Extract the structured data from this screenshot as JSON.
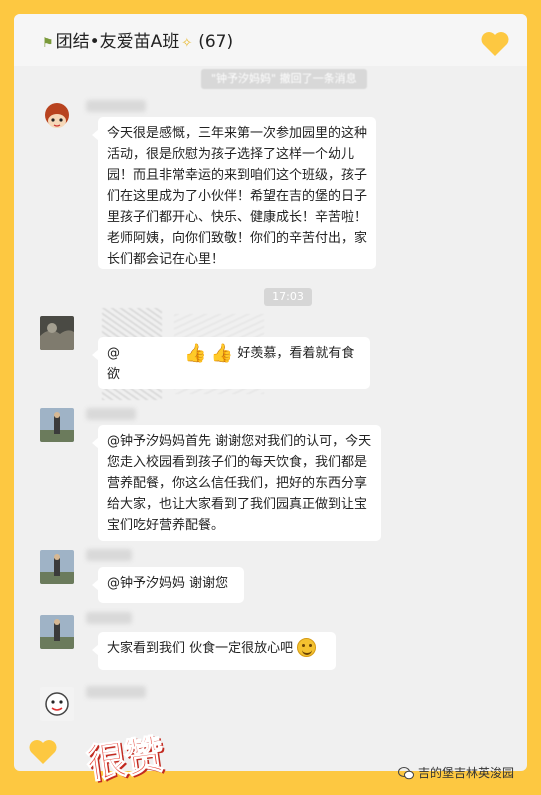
{
  "chat": {
    "title": "团结•友爱苗A班",
    "member_count": "(67)",
    "system_notice": "\"钟予汐妈妈\" 撤回了一条消息",
    "time_chip": "17:03"
  },
  "messages": [
    {
      "text": "今天很是感慨，三年来第一次参加园里的这种活动，很是欣慰为孩子选择了这样一个幼儿园！而且非常幸运的来到咱们这个班级，孩子们在这里成为了小伙伴！希望在吉的堡的日子里孩子们都开心、快乐、健康成长！辛苦啦！老师阿姨，向你们致敬！你们的辛苦付出，家长们都会记在心里！"
    },
    {
      "prefix": "@",
      "text": "好羡慕，看着就有食欲"
    },
    {
      "text": "@钟予汐妈妈首先 谢谢您对我们的认可，今天您走入校园看到孩子们的每天饮食，我们都是营养配餐，你这么信任我们，把好的东西分享给大家，也让大家看到了我们园真正做到让宝宝们吃好营养配餐。"
    },
    {
      "text": "@钟予汐妈妈 谢谢您"
    },
    {
      "text": "大家看到我们 伙食一定很放心吧"
    }
  ],
  "overlay": {
    "stamp_text": "很赞",
    "watermark_text": "吉的堡吉林英浚园"
  },
  "icons": {
    "heart": "heart-icon",
    "thumbs": "thumbs-up-icon",
    "smile": "smile-emoji-icon",
    "wechat": "wechat-icon"
  },
  "colors": {
    "frame": "#fdc841",
    "panel": "#f0f0f0",
    "heart": "#fdc841",
    "stamp": "#e53b2f"
  }
}
